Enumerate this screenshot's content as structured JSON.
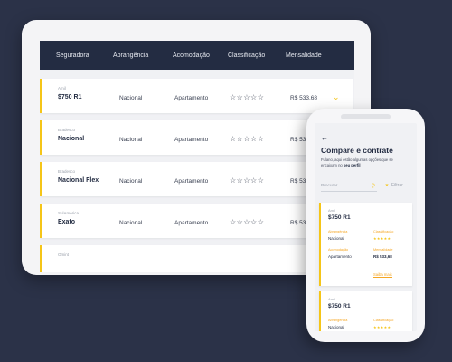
{
  "table": {
    "headers": [
      "Seguradora",
      "Abrangência",
      "Acomodação",
      "Classificação",
      "Mensalidade"
    ],
    "rows": [
      {
        "insurer": "Amil",
        "plan": "$750 R1",
        "coverage": "Nacional",
        "accommodation": "Apartamento",
        "stars": "☆☆☆☆☆",
        "price": "R$ 533,68",
        "expand_icon": "chevron-down-icon"
      },
      {
        "insurer": "Bradesco",
        "plan": "Nacional",
        "coverage": "Nacional",
        "accommodation": "Apartamento",
        "stars": "☆☆☆☆☆",
        "price": "R$ 533,6"
      },
      {
        "insurer": "Bradesco",
        "plan": "Nacional Flex",
        "coverage": "Nacional",
        "accommodation": "Apartamento",
        "stars": "☆☆☆☆☆",
        "price": "R$ 533,6"
      },
      {
        "insurer": "SulAmerica",
        "plan": "Exato",
        "coverage": "Nacional",
        "accommodation": "Apartamento",
        "stars": "☆☆☆☆☆",
        "price": "R$ 533,6"
      },
      {
        "insurer": "Omint",
        "plan": "",
        "coverage": "",
        "accommodation": "",
        "stars": "",
        "price": ""
      }
    ]
  },
  "phone": {
    "back_icon": "arrow-left-icon",
    "title": "Compare e contrate",
    "subtitle_prefix": "Fulano, aqui estão algumas opções que se encaixam no",
    "subtitle_bold": "seu perfil",
    "search_placeholder": "Procurar",
    "search_icon": "search-icon",
    "filter_label": "Filtrar",
    "filter_icon": "filter-icon",
    "cards": [
      {
        "insurer": "Amil",
        "plan": "$750 R1",
        "coverage_label": "Abrangência",
        "coverage": "Nacional",
        "rating_label": "Classificação",
        "stars": "★★★★★",
        "accommodation_label": "Acomodação",
        "accommodation": "Apartamento",
        "price_label": "Mensalidade",
        "price": "R$ 533,68",
        "more_label": "Saiba mais"
      },
      {
        "insurer": "Amil",
        "plan": "$750 R1",
        "coverage_label": "Abrangência",
        "coverage": "Nacional",
        "rating_label": "Classificação",
        "stars": "★★★★★"
      }
    ]
  },
  "colors": {
    "navy": "#232c42",
    "accent": "#f5c518",
    "background": "#2b3248"
  }
}
